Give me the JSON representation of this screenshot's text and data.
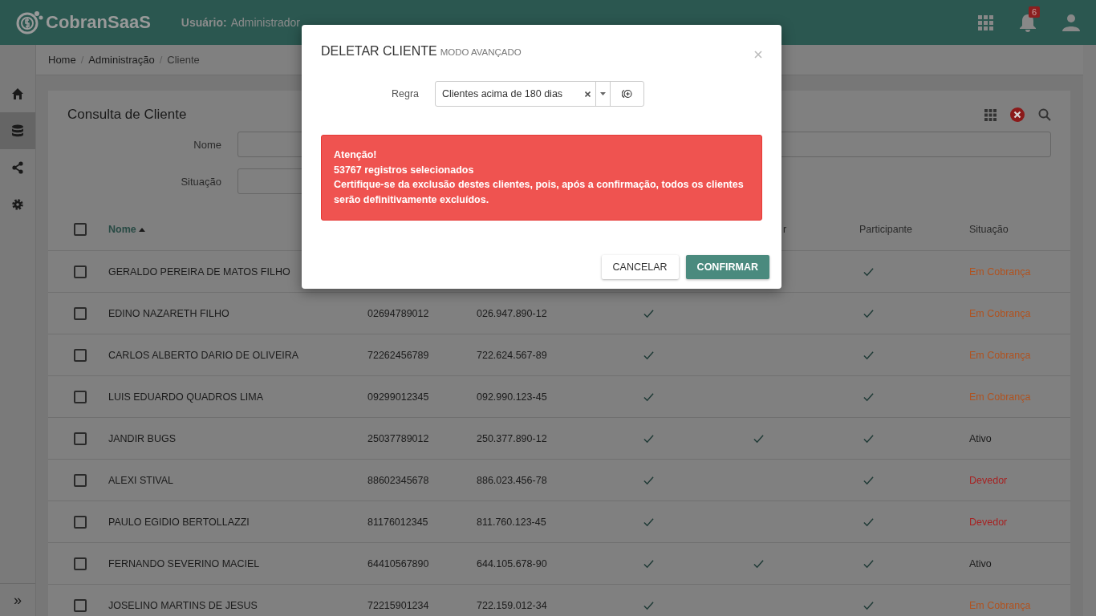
{
  "top_bar": {
    "logo": "CobranSaaS",
    "user_label": "Usuário:",
    "user": "Administrador",
    "notification_count": "6"
  },
  "sidebar": {
    "items": [
      {
        "selected": false
      },
      {
        "selected": true
      },
      {
        "selected": false
      },
      {
        "selected": false
      }
    ],
    "expand": "»"
  },
  "breadcrumb": {
    "separator": "/",
    "items": [
      "Home",
      "Administração",
      "Cliente"
    ]
  },
  "card": {
    "title": "Consulta de Cliente",
    "filters": [
      {
        "label": "Nome"
      },
      {
        "label": "Situação"
      }
    ],
    "table": {
      "select_all_checked": false,
      "columns": [
        {
          "label": "Nome",
          "sorted": true
        },
        {},
        {},
        {},
        {
          "label": "r"
        },
        {
          "label": "Participante"
        },
        {
          "label": "Situação"
        }
      ],
      "rows": [
        {
          "checked": false,
          "name": "GERALDO PEREIRA DE MATOS FILHO",
          "participante": true,
          "status": "Em Cobrança",
          "color": "#b0521f"
        },
        {
          "checked": false,
          "name": "EDINO NAZARETH FILHO",
          "column_2": "02694789012",
          "column_3": "026.947.890-12",
          "column_4": true,
          "column_5": false,
          "participante": true,
          "status": "Em Cobrança",
          "color": "#b0521f"
        },
        {
          "checked": false,
          "name": "CARLOS ALBERTO DARIO DE OLIVEIRA",
          "column_2": "72262456789",
          "column_3": "722.624.567-89",
          "column_4": true,
          "column_5": false,
          "participante": true,
          "status": "Em Cobrança",
          "color": "#b0521f"
        },
        {
          "checked": false,
          "name": "LUIS EDUARDO QUADROS LIMA",
          "column_2": "09299012345",
          "column_3": "092.990.123-45",
          "column_4": true,
          "column_5": false,
          "participante": true,
          "status": "Em Cobrança",
          "color": "#b0521f"
        },
        {
          "checked": false,
          "name": "JANDIR BUGS",
          "column_2": "25037789012",
          "column_3": "250.377.890-12",
          "column_4": true,
          "column_5": true,
          "participante": true,
          "status": "Ativo",
          "color": "#1a1a1a"
        },
        {
          "checked": false,
          "name": "ALEXI STIVAL",
          "column_2": "88602345678",
          "column_3": "886.023.456-78",
          "column_4": true,
          "column_5": false,
          "participante": true,
          "status": "Devedor",
          "color": "#a62222"
        },
        {
          "checked": false,
          "name": "PAULO EGIDIO BERTOLLAZZI",
          "column_2": "81176012345",
          "column_3": "811.760.123-45",
          "column_4": true,
          "column_5": false,
          "participante": true,
          "status": "Devedor",
          "color": "#a62222"
        },
        {
          "checked": false,
          "name": "FERNANDO SEVERINO MACIEL",
          "column_2": "64410567890",
          "column_3": "644.105.678-90",
          "column_4": true,
          "column_5": true,
          "participante": true,
          "status": "Ativo",
          "color": "#1a1a1a"
        },
        {
          "checked": false,
          "name": "JOSELINO MARTINS DE JESUS",
          "column_2": "72215901234",
          "column_3": "722.159.012-34",
          "column_4": true,
          "column_5": false,
          "participante": true,
          "status": "Em Cobrança",
          "color": "#b0521f"
        }
      ]
    }
  },
  "modal": {
    "title": "DELETAR CLIENTE",
    "subtitle": "MODO AVANÇADO",
    "rule_label": "Regra",
    "rule_value": "Clientes acima de 180 dias",
    "alert": {
      "heading": "Atenção!",
      "count": "53767 registros selecionados",
      "message": "Certifique-se da exclusão destes clientes, pois, após a confirmação, todos os clientes serão definitivamente excluídos."
    },
    "buttons": [
      {
        "label": "CANCELAR",
        "kind": "secondary"
      },
      {
        "label": "CONFIRMAR",
        "kind": "primary"
      }
    ]
  }
}
